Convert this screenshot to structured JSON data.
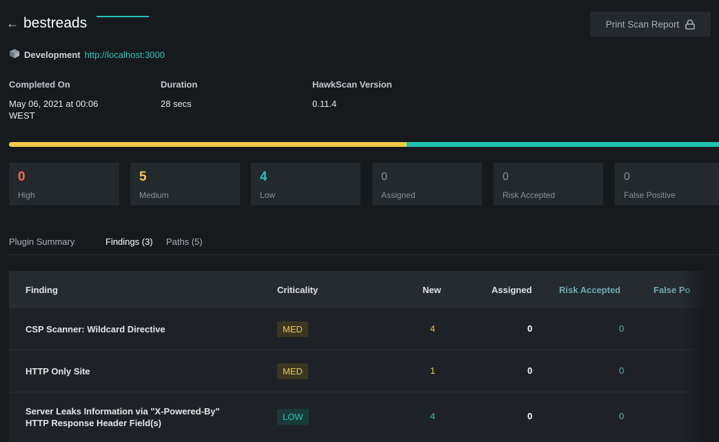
{
  "header": {
    "back_icon": "arrow-left-icon",
    "title": "bestreads",
    "print_label": "Print Scan Report",
    "print_icon": "lock-icon"
  },
  "environment": {
    "icon": "cube-icon",
    "name": "Development",
    "url": "http://localhost:3000"
  },
  "meta": {
    "completed_label": "Completed On",
    "completed_value_line1": "May 06, 2021 at 00:06",
    "completed_value_line2": "WEST",
    "duration_label": "Duration",
    "duration_value": "28 secs",
    "version_label": "HawkScan Version",
    "version_value": "0.11.4"
  },
  "progress": {
    "medium_fraction": 0.56,
    "low_fraction": 0.44,
    "medium_color": "#f2c94c",
    "low_color": "#21c4b8"
  },
  "stats": {
    "high": {
      "value": "0",
      "label": "High",
      "color": "#ff6b4a"
    },
    "medium": {
      "value": "5",
      "label": "Medium",
      "color": "#f2c94c"
    },
    "low": {
      "value": "4",
      "label": "Low",
      "color": "#21c4b8"
    },
    "assigned": {
      "value": "0",
      "label": "Assigned"
    },
    "risk_accepted": {
      "value": "0",
      "label": "Risk Accepted"
    },
    "false_positive": {
      "value": "0",
      "label": "False Positive"
    }
  },
  "tabs": [
    {
      "label": "Plugin Summary",
      "active": false
    },
    {
      "label": "Findings (3)",
      "active": true
    },
    {
      "label": "Paths (5)",
      "active": false
    }
  ],
  "table": {
    "columns": {
      "finding": "Finding",
      "criticality": "Criticality",
      "new": "New",
      "assigned": "Assigned",
      "risk_accepted": "Risk Accepted",
      "false_positive": "False Po"
    },
    "rows": [
      {
        "finding_line1": "CSP Scanner: Wildcard Directive",
        "finding_line2": "",
        "criticality": "MED",
        "new": "4",
        "assigned": "0",
        "risk_accepted": "0"
      },
      {
        "finding_line1": "HTTP Only Site",
        "finding_line2": "",
        "criticality": "MED",
        "new": "1",
        "assigned": "0",
        "risk_accepted": "0"
      },
      {
        "finding_line1": "Server Leaks Information via \"X-Powered-By\"",
        "finding_line2": "HTTP Response Header Field(s)",
        "criticality": "LOW",
        "new": "4",
        "assigned": "0",
        "risk_accepted": "0"
      }
    ]
  }
}
